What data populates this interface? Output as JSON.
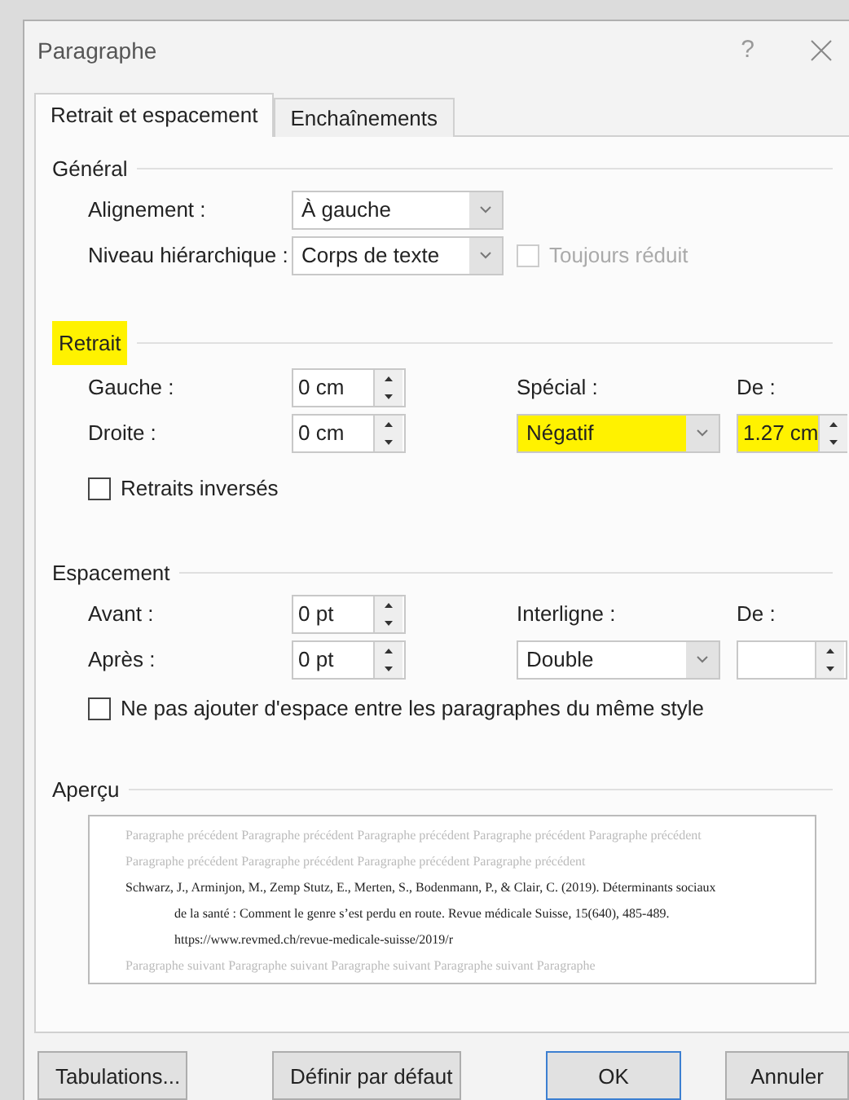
{
  "window": {
    "title": "Paragraphe",
    "help": "?"
  },
  "tabs": [
    {
      "label": "Retrait et espacement",
      "selected": true
    },
    {
      "label": "Enchaînements",
      "selected": false
    }
  ],
  "general": {
    "heading": "Général",
    "alignment": {
      "label": "Alignement :",
      "value": "À gauche"
    },
    "level": {
      "label": "Niveau hiérarchique :",
      "value": "Corps de texte"
    },
    "collapsed": {
      "label": "Toujours réduit",
      "checked": false,
      "disabled": true
    }
  },
  "indent": {
    "heading": "Retrait",
    "highlighted": true,
    "left": {
      "label": "Gauche :",
      "value": "0 cm"
    },
    "right": {
      "label": "Droite :",
      "value": "0 cm"
    },
    "special": {
      "label": "Spécial :",
      "value": "Négatif",
      "highlighted": true
    },
    "by": {
      "label": "De :",
      "value": "1.27 cm",
      "highlighted": true
    },
    "mirror": {
      "label": "Retraits inversés",
      "checked": false
    }
  },
  "spacing": {
    "heading": "Espacement",
    "before": {
      "label": "Avant :",
      "value": "0 pt"
    },
    "after": {
      "label": "Après :",
      "value": "0 pt"
    },
    "line": {
      "label": "Interligne :",
      "value": "Double"
    },
    "at": {
      "label": "De :"
    },
    "no_space": {
      "label": "Ne pas ajouter d'espace entre les paragraphes du même style",
      "checked": false
    }
  },
  "preview": {
    "heading": "Aperçu",
    "lines": [
      {
        "kind": "ghost",
        "text": "Paragraphe précédent Paragraphe précédent Paragraphe précédent Paragraphe précédent Paragraphe précédent"
      },
      {
        "kind": "ghost",
        "text": "Paragraphe précédent Paragraphe précédent Paragraphe précédent Paragraphe précédent"
      },
      {
        "kind": "entry",
        "text": "Schwarz, J., Arminjon, M., Zemp Stutz, E., Merten, S., Bodenmann, P., & Clair, C. (2019). Déterminants sociaux"
      },
      {
        "kind": "hanging",
        "text": "de la santé : Comment le genre s’est perdu en route. Revue médicale Suisse, 15(640), 485-489."
      },
      {
        "kind": "hanging",
        "text": "https://www.revmed.ch/revue-medicale-suisse/2019/r"
      },
      {
        "kind": "ghost",
        "text": "Paragraphe suivant Paragraphe suivant Paragraphe suivant Paragraphe suivant Paragraphe"
      }
    ]
  },
  "buttons": [
    {
      "label": "Tabulations...",
      "default": false
    },
    {
      "label": "Définir par défaut",
      "default": false
    },
    {
      "label": "OK",
      "default": true
    },
    {
      "label": "Annuler",
      "default": false
    }
  ]
}
